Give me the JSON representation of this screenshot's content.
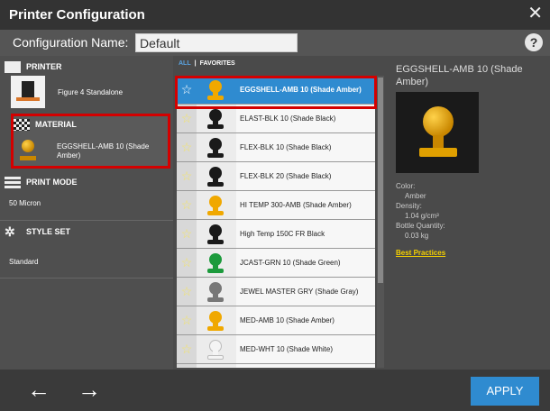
{
  "window": {
    "title": "Printer Configuration",
    "close_glyph": "✕"
  },
  "config": {
    "label": "Configuration Name:",
    "value": "Default",
    "help_glyph": "?"
  },
  "sections": {
    "printer": {
      "heading": "PRINTER",
      "value": "Figure 4 Standalone",
      "icon": "printer-icon"
    },
    "material": {
      "heading": "MATERIAL",
      "value": "EGGSHELL-AMB 10 (Shade Amber)",
      "icon": "checkerboard-icon"
    },
    "print_mode": {
      "heading": "PRINT MODE",
      "value": "50 Micron",
      "icon": "layers-icon"
    },
    "style_set": {
      "heading": "STYLE SET",
      "value": "Standard",
      "icon": "gear-icon"
    }
  },
  "tabs": {
    "all": "ALL",
    "separator": "|",
    "favorites": "FAVORITES"
  },
  "materials": [
    {
      "name": "EGGSHELL-AMB 10 (Shade Amber)",
      "color": "#f0a800",
      "selected": true
    },
    {
      "name": "ELAST-BLK 10 (Shade Black)",
      "color": "#1a1a1a"
    },
    {
      "name": "FLEX-BLK 10 (Shade Black)",
      "color": "#1a1a1a"
    },
    {
      "name": "FLEX-BLK 20 (Shade Black)",
      "color": "#1a1a1a"
    },
    {
      "name": "HI TEMP 300-AMB (Shade Amber)",
      "color": "#f0a800"
    },
    {
      "name": "High Temp 150C FR Black",
      "color": "#1a1a1a"
    },
    {
      "name": "JCAST-GRN 10 (Shade Green)",
      "color": "#1c9a3c"
    },
    {
      "name": "JEWEL MASTER GRY (Shade Gray)",
      "color": "#777777"
    },
    {
      "name": "MED-AMB 10 (Shade Amber)",
      "color": "#f0a800"
    },
    {
      "name": "MED-WHT 10 (Shade White)",
      "color": "#f4f4f4"
    },
    {
      "name": "",
      "color": "#1a1a1a"
    }
  ],
  "details": {
    "title": "EGGSHELL-AMB 10 (Shade Amber)",
    "color_label": "Color:",
    "color_value": "Amber",
    "density_label": "Density:",
    "density_value": "1.04 g/cm³",
    "bottle_label": "Bottle Quantity:",
    "bottle_value": "0.03 kg",
    "link": "Best Practices"
  },
  "footer": {
    "back_glyph": "←",
    "forward_glyph": "→",
    "apply": "APPLY"
  }
}
